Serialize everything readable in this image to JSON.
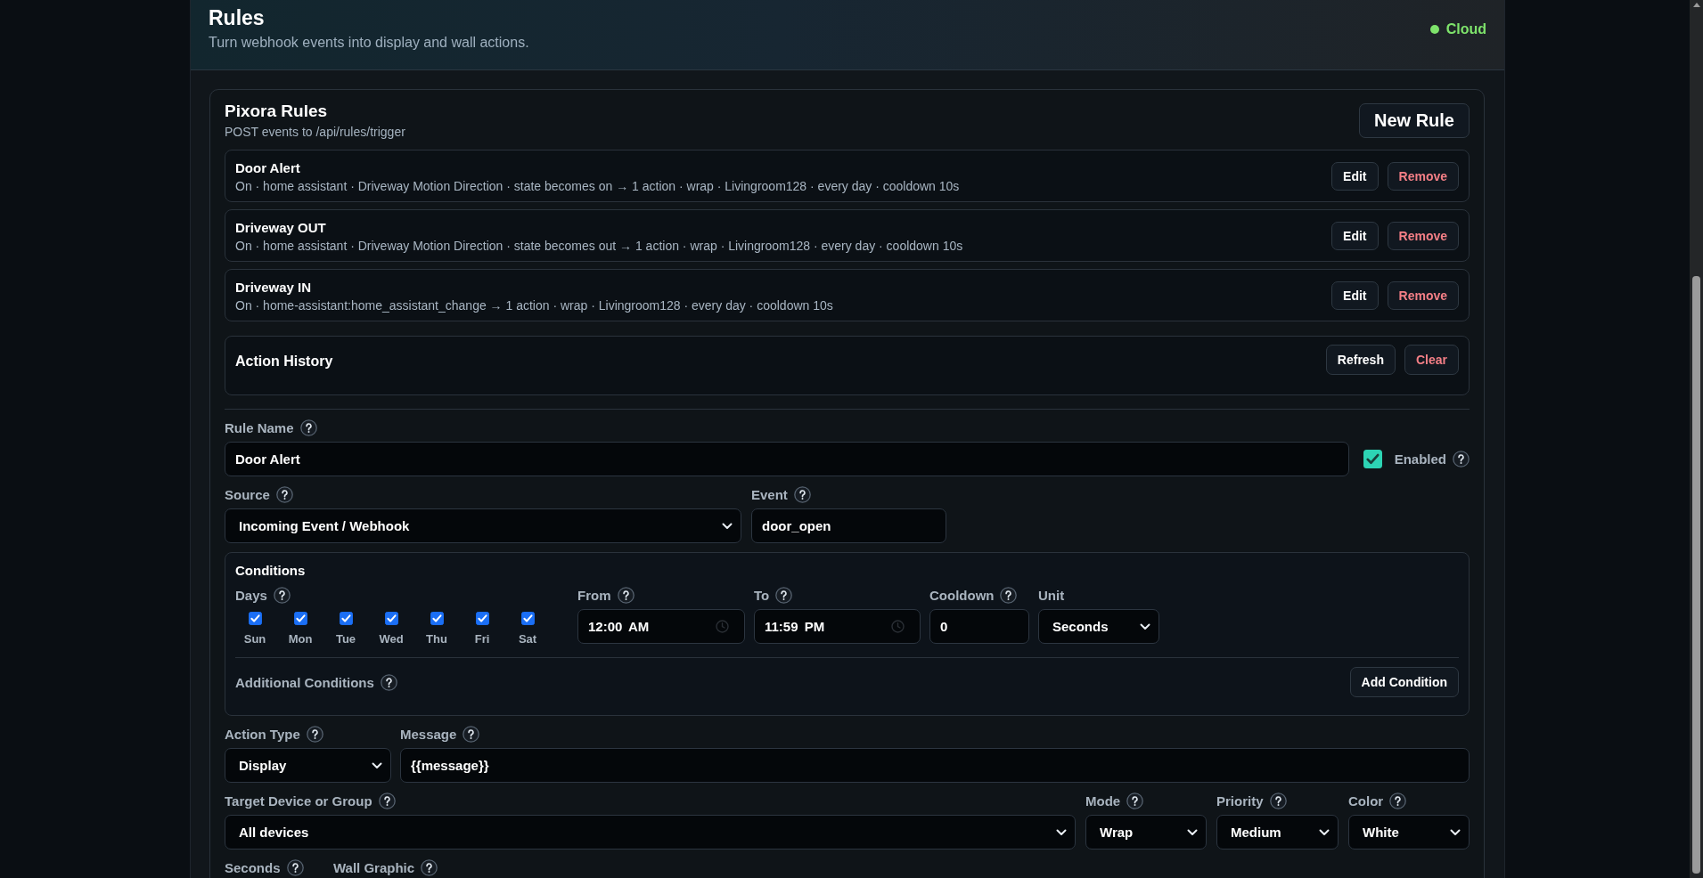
{
  "header": {
    "title": "Rules",
    "subtitle": "Turn webhook events into display and wall actions.",
    "status": {
      "label": "Cloud",
      "connected": true
    }
  },
  "rules_panel": {
    "title": "Pixora Rules",
    "subtitle": "POST events to /api/rules/trigger",
    "new_rule_button": "New Rule",
    "rules": [
      {
        "name": "Door Alert",
        "summary": "On · home assistant · Driveway Motion Direction · state becomes on → 1 action · wrap · Livingroom128 · every day · cooldown 10s",
        "edit_button": "Edit",
        "remove_button": "Remove"
      },
      {
        "name": "Driveway OUT",
        "summary": "On · home assistant · Driveway Motion Direction · state becomes out → 1 action · wrap · Livingroom128 · every day · cooldown 10s",
        "edit_button": "Edit",
        "remove_button": "Remove"
      },
      {
        "name": "Driveway IN",
        "summary": "On · home-assistant:home_assistant_change → 1 action · wrap · Livingroom128 · every day · cooldown 10s",
        "edit_button": "Edit",
        "remove_button": "Remove"
      }
    ],
    "action_history": {
      "title": "Action History",
      "refresh_button": "Refresh",
      "clear_button": "Clear"
    }
  },
  "form": {
    "rule_name": {
      "label": "Rule Name",
      "help": true,
      "kind": "text",
      "value": "Door Alert"
    },
    "enabled": {
      "label": "Enabled",
      "help": true,
      "checked": true
    },
    "source": {
      "label": "Source",
      "help": true,
      "kind": "select",
      "value": "Incoming Event / Webhook"
    },
    "event": {
      "label": "Event",
      "help": true,
      "kind": "text",
      "value": "door_open"
    },
    "conditions": {
      "title": "Conditions",
      "days": {
        "label": "Days",
        "help": true,
        "items": [
          {
            "label": "Sun",
            "checked": true
          },
          {
            "label": "Mon",
            "checked": true
          },
          {
            "label": "Tue",
            "checked": true
          },
          {
            "label": "Wed",
            "checked": true
          },
          {
            "label": "Thu",
            "checked": true
          },
          {
            "label": "Fri",
            "checked": true
          },
          {
            "label": "Sat",
            "checked": true
          }
        ]
      },
      "from": {
        "label": "From",
        "help": true,
        "kind": "time",
        "value": "12:00 AM"
      },
      "to": {
        "label": "To",
        "help": true,
        "kind": "time",
        "value": "11:59 PM"
      },
      "cooldown": {
        "label": "Cooldown",
        "help": true,
        "kind": "text",
        "value": "0"
      },
      "unit": {
        "label": "Unit",
        "help": false,
        "kind": "select",
        "value": "Seconds"
      },
      "additional": {
        "label": "Additional Conditions",
        "help": true
      },
      "add_condition_button": "Add Condition"
    },
    "action_type": {
      "label": "Action Type",
      "help": true,
      "kind": "select",
      "value": "Display"
    },
    "message": {
      "label": "Message",
      "help": true,
      "kind": "text",
      "value": "{{message}}"
    },
    "target": {
      "label": "Target Device or Group",
      "help": true,
      "kind": "select",
      "value": "All devices"
    },
    "mode": {
      "label": "Mode",
      "help": true,
      "kind": "select",
      "value": "Wrap"
    },
    "priority": {
      "label": "Priority",
      "help": true,
      "kind": "select",
      "value": "Medium"
    },
    "color": {
      "label": "Color",
      "help": true,
      "kind": "select",
      "value": "White"
    },
    "seconds": {
      "label": "Seconds",
      "help": true
    },
    "wall_graphic": {
      "label": "Wall Graphic",
      "help": true
    }
  }
}
